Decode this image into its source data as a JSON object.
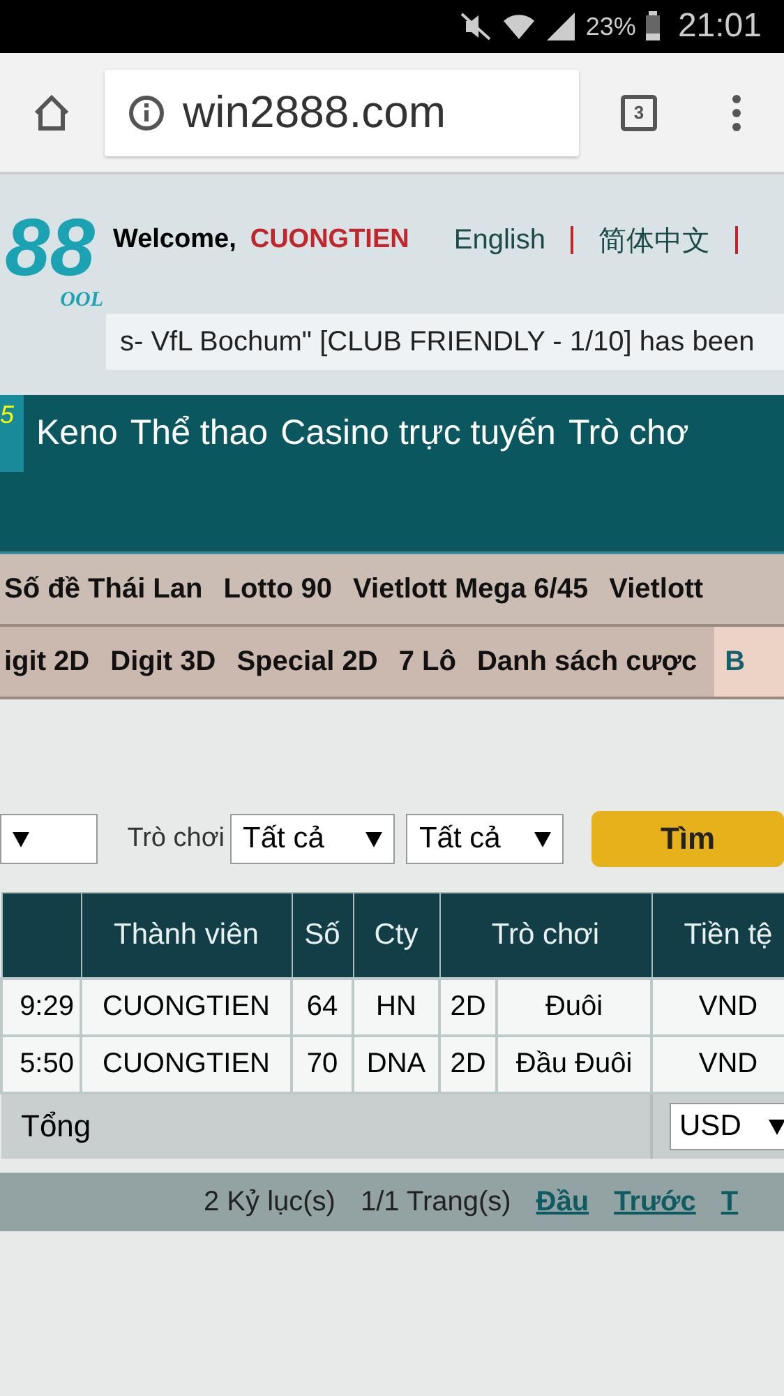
{
  "status_bar": {
    "battery": "23%",
    "time": "21:01"
  },
  "browser": {
    "url": "win2888.com",
    "tab_count": "3"
  },
  "header": {
    "logo": "88",
    "logo_sub": "OOL",
    "welcome": "Welcome,",
    "username": "CUONGTIEN",
    "languages": [
      "English",
      "简体中文"
    ],
    "ticker": "s- VfL Bochum\" [CLUB FRIENDLY - 1/10] has been"
  },
  "main_nav": {
    "badge": "5",
    "items": [
      "Keno",
      "Thể thao",
      "Casino trực tuyến",
      "Trò chơ"
    ]
  },
  "sub_nav_1": [
    {
      "label": "Số đề Thái Lan",
      "selected": false
    },
    {
      "label": "Lotto 90",
      "selected": false
    },
    {
      "label": "Vietlott Mega 6/45",
      "selected": false
    },
    {
      "label": "Vietlott",
      "selected": false
    }
  ],
  "sub_nav_2": [
    {
      "label": "igit 2D",
      "selected": false
    },
    {
      "label": "Digit 3D",
      "selected": false
    },
    {
      "label": "Special 2D",
      "selected": false
    },
    {
      "label": "7 Lô",
      "selected": false
    },
    {
      "label": "Danh sách cược",
      "selected": false
    },
    {
      "label": "B",
      "selected": true
    }
  ],
  "filters": {
    "game_label": "Trò chơi",
    "selects": [
      "Tất cả",
      "Tất cả"
    ],
    "search_button": "Tìm"
  },
  "table": {
    "columns": [
      {},
      {
        "label": "Thành viên"
      },
      {
        "label": "Số"
      },
      {
        "label": "Cty"
      },
      {
        "label": "Trò chơi",
        "colspan": 2
      },
      {
        "label": "Tiền tệ"
      }
    ],
    "rows": [
      [
        "9:29",
        "CUONGTIEN",
        "64",
        "HN",
        "2D",
        "Đuôi",
        "VND"
      ],
      [
        "5:50",
        "CUONGTIEN",
        "70",
        "DNA",
        "2D",
        "Đầu Đuôi",
        "VND"
      ]
    ],
    "total_label": "Tổng",
    "currency": "USD"
  },
  "pager": {
    "records": "2 Kỷ lục(s)",
    "pages": "1/1 Trang(s)",
    "links": [
      "Đầu",
      "Trước",
      "T"
    ]
  }
}
